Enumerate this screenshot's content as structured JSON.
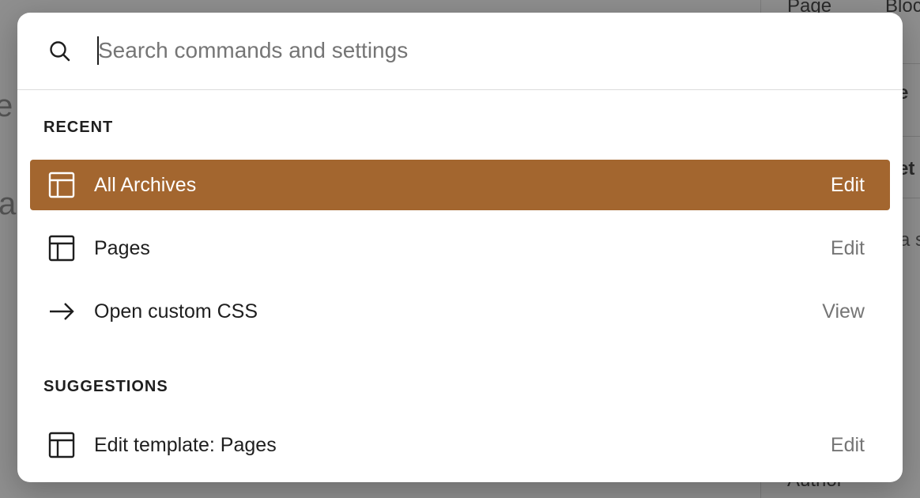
{
  "background": {
    "sidebar_texts": [
      "Page",
      "Bloc",
      "e",
      "et",
      "a s",
      "Author"
    ],
    "left_glyphs": [
      "e",
      "a"
    ]
  },
  "palette": {
    "search": {
      "placeholder": "Search commands and settings",
      "value": "",
      "icon": "search-icon"
    },
    "sections": [
      {
        "heading": "RECENT",
        "items": [
          {
            "label": "All Archives",
            "action": "Edit",
            "icon": "layout-icon",
            "active": true
          },
          {
            "label": "Pages",
            "action": "Edit",
            "icon": "layout-icon",
            "active": false
          },
          {
            "label": "Open custom CSS",
            "action": "View",
            "icon": "arrow-right-icon",
            "active": false
          }
        ]
      },
      {
        "heading": "SUGGESTIONS",
        "items": [
          {
            "label": "Edit template: Pages",
            "action": "Edit",
            "icon": "layout-icon",
            "active": false
          }
        ]
      }
    ]
  },
  "colors": {
    "accent": "#a3662f",
    "overlay": "#8f8f8f",
    "text": "#1e1e1e",
    "muted": "#757575"
  }
}
